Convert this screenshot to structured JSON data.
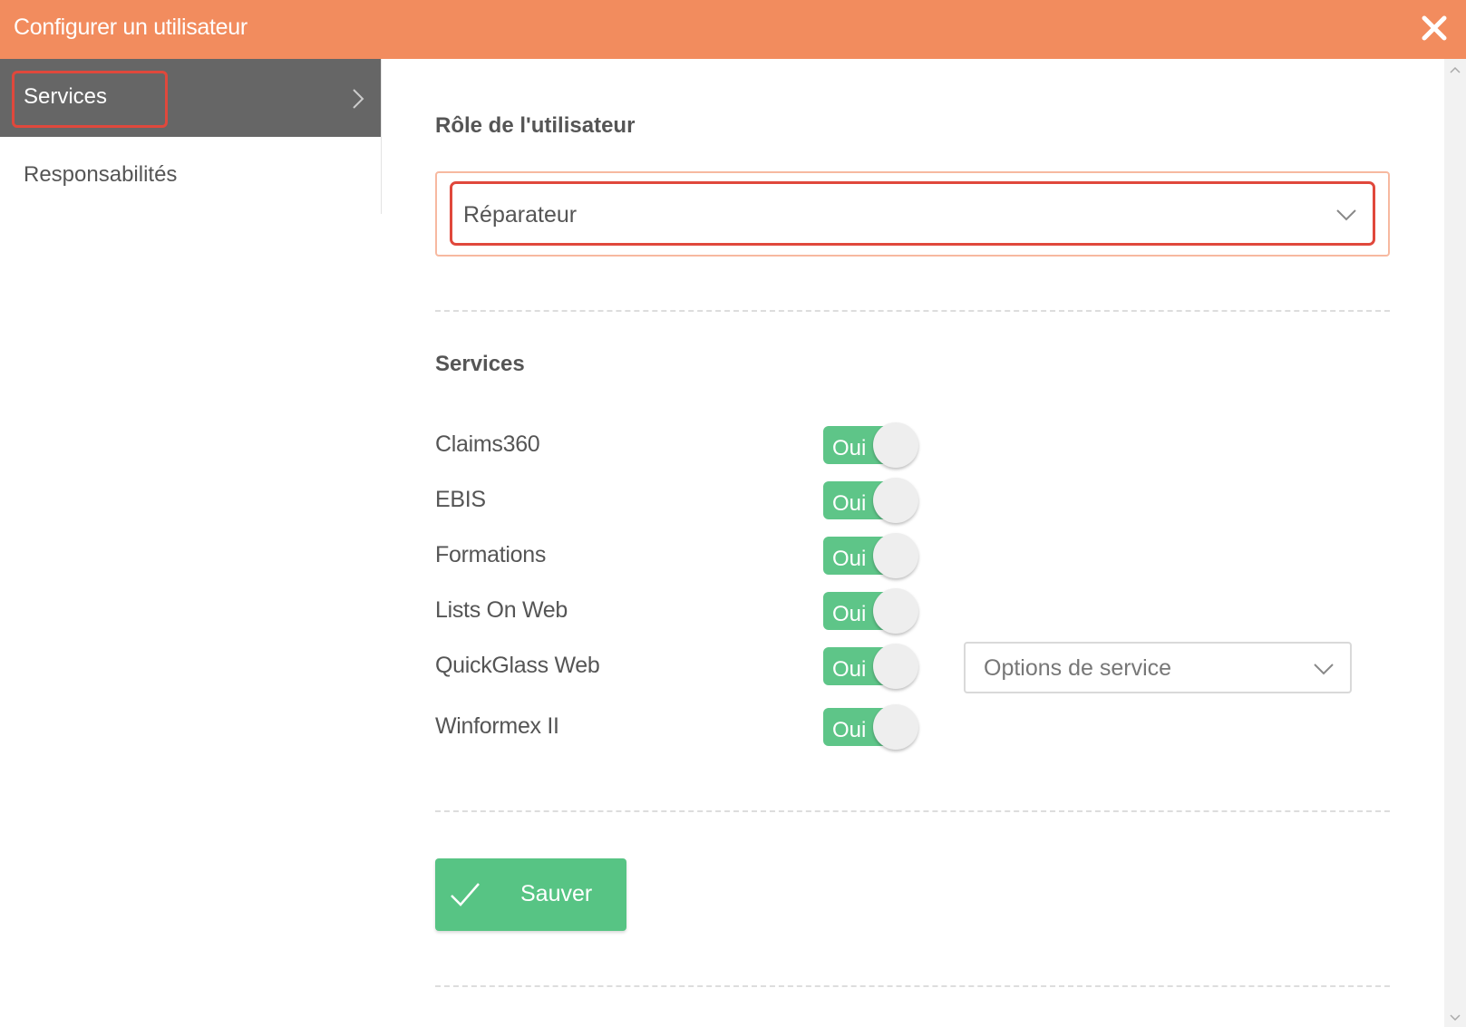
{
  "dialog": {
    "title": "Configurer un utilisateur"
  },
  "sidebar": {
    "items": [
      {
        "label": "Services"
      },
      {
        "label": "Responsabilités"
      }
    ]
  },
  "role": {
    "heading": "Rôle de l'utilisateur",
    "selected": "Réparateur"
  },
  "services": {
    "heading": "Services",
    "items": [
      {
        "name": "Claims360",
        "toggle": "Oui"
      },
      {
        "name": "EBIS",
        "toggle": "Oui"
      },
      {
        "name": "Formations",
        "toggle": "Oui"
      },
      {
        "name": "Lists On Web",
        "toggle": "Oui"
      },
      {
        "name": "QuickGlass Web",
        "toggle": "Oui"
      },
      {
        "name": "Winformex II",
        "toggle": "Oui"
      }
    ],
    "options_placeholder": "Options de service"
  },
  "actions": {
    "save_label": "Sauver"
  },
  "colors": {
    "header": "#f28c5e",
    "toggle_on": "#5ec588",
    "save": "#57c484",
    "highlight": "#e0483c",
    "sidebar_active": "#666666"
  },
  "icons": {
    "close": "close-icon",
    "chevron_right": "chevron-right-icon",
    "chevron_down": "chevron-down-icon",
    "check": "check-icon"
  }
}
